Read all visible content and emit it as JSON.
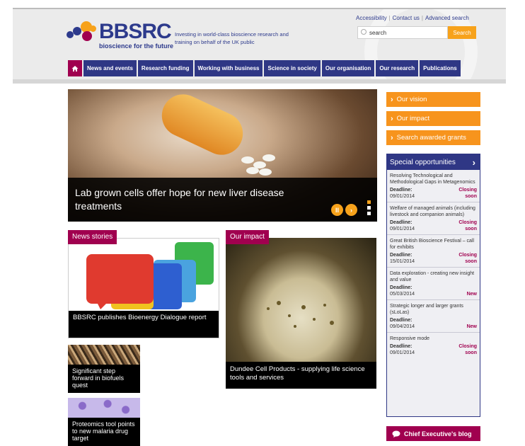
{
  "header": {
    "logo_word": "BBSRC",
    "logo_sub": "bioscience for the future",
    "tagline": "Investing in world-class bioscience research and training on behalf of the UK public",
    "utility_links": [
      "Accessibility",
      "Contact us",
      "Advanced search"
    ],
    "search": {
      "value": "search",
      "button": "Search"
    }
  },
  "nav": {
    "items": [
      "News and events",
      "Research funding",
      "Working with business",
      "Science in society",
      "Our organisation",
      "Our research",
      "Publications"
    ]
  },
  "hero": {
    "caption": "Lab grown cells offer hope for new liver disease treatments",
    "pause_glyph": "II",
    "next_glyph": "›"
  },
  "news": {
    "tag": "News stories",
    "main_caption": "BBSRC publishes Bioenergy Dialogue report",
    "small": [
      {
        "caption": "Significant step forward in biofuels quest"
      },
      {
        "caption": "Proteomics tool points to new malaria drug target"
      }
    ]
  },
  "impact": {
    "tag": "Our impact",
    "caption": "Dundee Cell Products - supplying life science tools and services"
  },
  "sidebar": {
    "buttons": [
      "Our vision",
      "Our impact",
      "Search awarded grants"
    ],
    "opportunities_title": "Special opportunities",
    "opportunities": [
      {
        "title": "Resolving Technological and Methodological Gaps in Metagenomics",
        "deadline_label": "Deadline:",
        "date": "09/01/2014",
        "status": "Closing soon"
      },
      {
        "title": "Welfare of managed animals (including livestock and companion animals)",
        "deadline_label": "Deadline:",
        "date": "09/01/2014",
        "status": "Closing soon"
      },
      {
        "title": "Great British Bioscience Festival – call for exhibits",
        "deadline_label": "Deadline:",
        "date": "15/01/2014",
        "status": "Closing soon"
      },
      {
        "title": "Data exploration - creating new insight and value",
        "deadline_label": "Deadline:",
        "date": "05/03/2014",
        "status": "New"
      },
      {
        "title": "Strategic longer and larger grants (sLoLas)",
        "deadline_label": "Deadline:",
        "date": "09/04/2014",
        "status": "New"
      },
      {
        "title": "Responsive mode",
        "deadline_label": "Deadline:",
        "date": "09/01/2014",
        "status": "Closing soon"
      }
    ],
    "blog": "Chief Executive's blog"
  },
  "colors": {
    "brand_navy": "#2f3785",
    "brand_magenta": "#a0004f",
    "accent_orange": "#f7941d"
  }
}
